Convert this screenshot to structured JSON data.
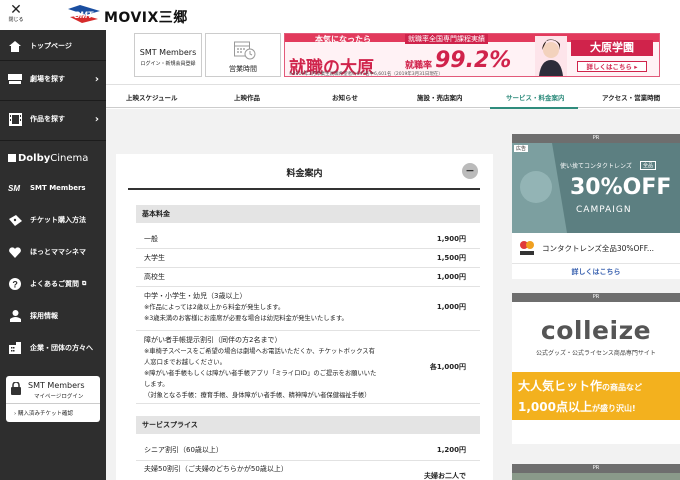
{
  "topbar": {
    "close_label": "閉じる",
    "logo_text": "SMT",
    "site_title": "MOVIX三郷"
  },
  "sidebar": {
    "items": [
      {
        "label": "トップページ",
        "icon": "home-icon",
        "chevron": false
      },
      {
        "label": "劇場を探す",
        "icon": "theater-icon",
        "chevron": true
      },
      {
        "label": "作品を探す",
        "icon": "film-icon",
        "chevron": true
      }
    ],
    "dolby_label": "Dolby",
    "dolby_label2": "Cinema",
    "items2": [
      {
        "label": "SMT Members",
        "icon": "smt-icon"
      },
      {
        "label": "チケット購入方法",
        "icon": "ticket-icon"
      },
      {
        "label": "ほっとママシネマ",
        "icon": "heart-icon"
      },
      {
        "label": "よくあるご質問",
        "icon": "question-icon"
      },
      {
        "label": "採用情報",
        "icon": "person-icon"
      },
      {
        "label": "企業・団体の方々へ",
        "icon": "building-icon"
      }
    ],
    "members": {
      "title": "SMT Members",
      "subtitle": "マイページログイン",
      "purchased": "購入済みチケット確認"
    }
  },
  "header": {
    "smt_title": "SMT Members",
    "smt_sub": "ログイン・新規会員登録",
    "hours_label": "営業時間",
    "ad": {
      "line1": "本気になったら",
      "line2": "就職の大原",
      "line3": "就職率全国専門課程実績",
      "line4": "就職率",
      "percent": "99.2%",
      "footnote": "※2019年3月卒業生就職希望者6,647名中6,601名（2019年3月31日現在）",
      "brand": "大原学園",
      "cta": "詳しくはこちら ▸"
    }
  },
  "nav": {
    "tabs": [
      "上映スケジュール",
      "上映作品",
      "お知らせ",
      "施設・売店案内",
      "サービス・料金案内",
      "アクセス・営業時間"
    ],
    "active_index": 4
  },
  "pricing": {
    "title": "料金案内",
    "collapse_symbol": "−",
    "section1": "基本料金",
    "basic": [
      {
        "label": "一般",
        "price": "1,900円"
      },
      {
        "label": "大学生",
        "price": "1,500円"
      },
      {
        "label": "高校生",
        "price": "1,000円"
      }
    ],
    "child": {
      "label": "中学・小学生・幼児（3歳以上）",
      "note1": "※作品によっては2歳以上から料金が発生します。",
      "note2": "※3歳未満のお客様にお座席が必要な場合は幼児料金が発生いたします。",
      "price": "1,000円"
    },
    "disabled": {
      "label": "障がい者手帳提示割引（同伴の方2名まで）",
      "note1": "※車椅子スペースをご希望の場合は劇場へお電話いただくか、チケットボックス有",
      "note2": "人窓口までお越しください。",
      "note3": "※障がい者手帳もしくは障がい者手帳アプリ「ミライロID」のご提示をお願いいた",
      "note4": "します。",
      "note5": "（対象となる手帳：療育手帳、身体障がい者手帳、精神障がい者保健福祉手帳）",
      "price": "各1,000円"
    },
    "section2": "サービスプライス",
    "service": [
      {
        "label": "シニア割引（60歳以上）",
        "price": "1,200円"
      },
      {
        "label": "夫婦50割引（ご夫婦のどちらかが50歳以上）",
        "price": "夫婦お二人で"
      }
    ]
  },
  "ads": {
    "pr_label": "PR",
    "lens": {
      "tag": "広告",
      "small": "使い捨てコンタクトレンズ",
      "badge": "全品",
      "big": "30%OFF",
      "campaign": "CAMPAIGN",
      "text": "コンタクトレンズ全品30%OFF...",
      "more": "詳しくはこちら"
    },
    "colleize": {
      "logo": "colleize",
      "sub": "公式グッズ・公式ライセンス商品専門サイト",
      "line1a": "大人気ヒット作",
      "line1b": "の商品など",
      "line2a": "1,000点以上",
      "line2b": "が盛り沢山!"
    }
  },
  "colors": {
    "sidebar_bg": "#2e2e2e",
    "accent_green": "#2f8c7d",
    "ad_red": "#d0234b",
    "lens_bg": "#5c7f81",
    "colleize_orange": "#f3b11e"
  }
}
